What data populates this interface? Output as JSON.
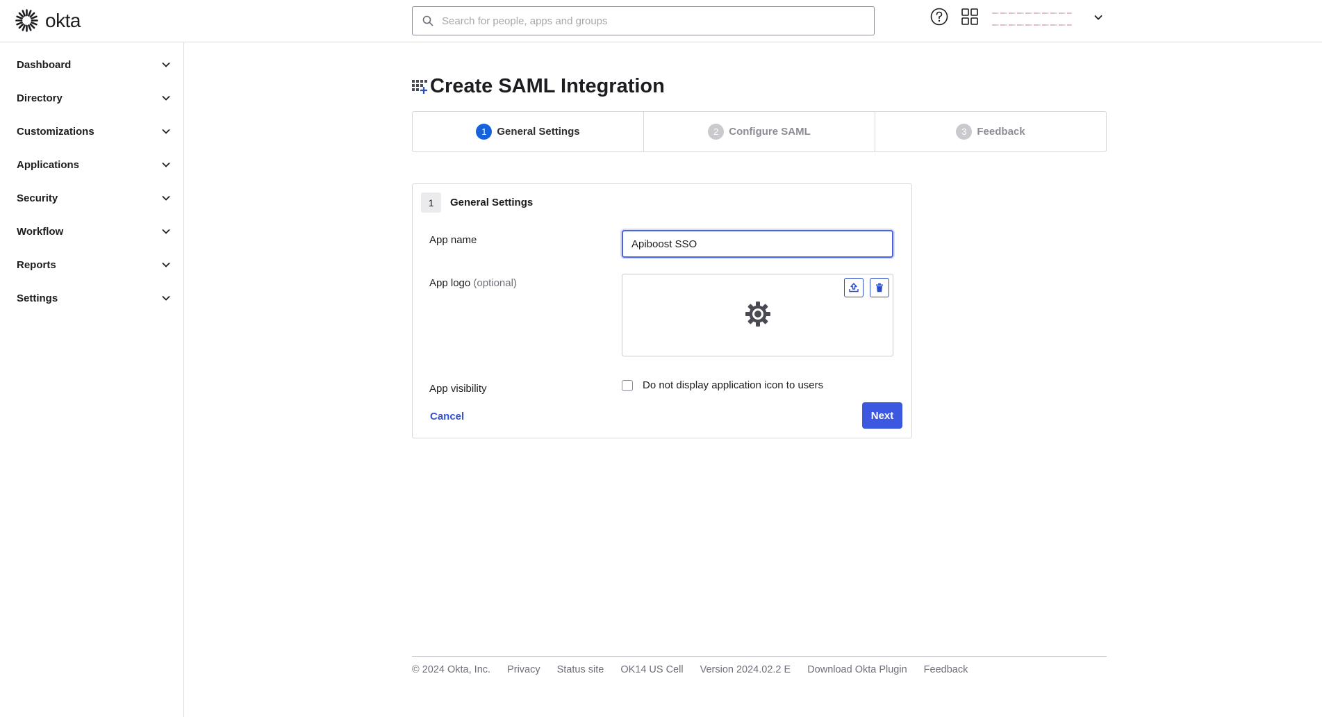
{
  "header": {
    "brand": "okta",
    "search": {
      "placeholder": "Search for people, apps and groups",
      "value": ""
    }
  },
  "sidebar": {
    "items": [
      {
        "label": "Dashboard"
      },
      {
        "label": "Directory"
      },
      {
        "label": "Customizations"
      },
      {
        "label": "Applications"
      },
      {
        "label": "Security"
      },
      {
        "label": "Workflow"
      },
      {
        "label": "Reports"
      },
      {
        "label": "Settings"
      }
    ]
  },
  "main": {
    "title": "Create SAML Integration",
    "steps": [
      {
        "num": "1",
        "label": "General Settings",
        "state": "active"
      },
      {
        "num": "2",
        "label": "Configure SAML",
        "state": "inactive"
      },
      {
        "num": "3",
        "label": "Feedback",
        "state": "inactive"
      }
    ],
    "form": {
      "section_num": "1",
      "section_title": "General Settings",
      "app_name_label": "App name",
      "app_name_value": "Apiboost SSO",
      "app_logo_label": "App logo",
      "app_logo_optional": "(optional)",
      "app_visibility_label": "App visibility",
      "visibility_checkbox_label": "Do not display application icon to users",
      "visibility_checked": false,
      "cancel_label": "Cancel",
      "next_label": "Next"
    }
  },
  "footer": {
    "copyright": "© 2024 Okta, Inc.",
    "links": [
      "Privacy",
      "Status site",
      "OK14 US Cell",
      "Version 2024.02.2 E",
      "Download Okta Plugin",
      "Feedback"
    ]
  },
  "colors": {
    "accent": "#3c58e0",
    "step_active": "#1662dd",
    "link": "#3351d3",
    "border": "#d7d7dc"
  },
  "icons": [
    "okta-logo-icon",
    "search-icon",
    "help-icon",
    "apps-grid-icon",
    "chevron-down-icon",
    "add-app-icon",
    "upload-icon",
    "trash-icon",
    "gear-icon"
  ]
}
